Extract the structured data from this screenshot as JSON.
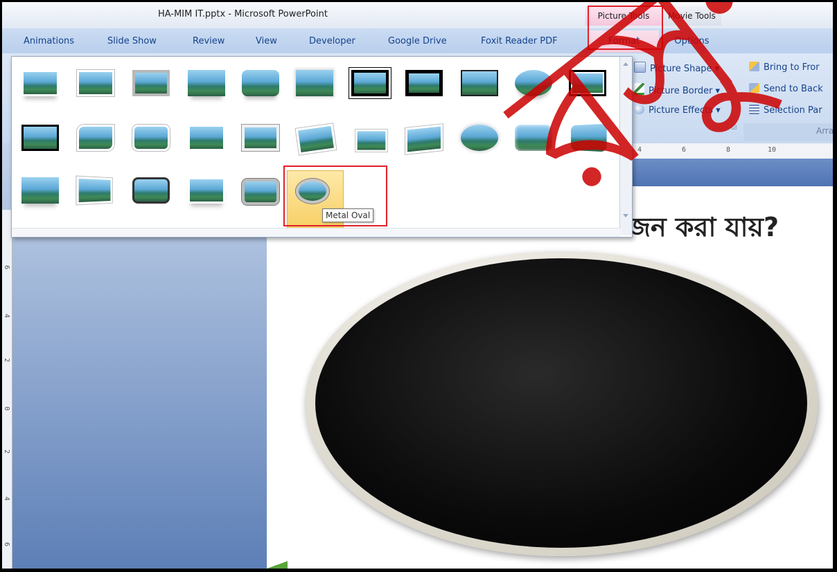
{
  "window": {
    "title": "HA-MIM IT.pptx - Microsoft PowerPoint"
  },
  "context_tabs": {
    "picture_tools": "Picture Tools",
    "movie_tools": "Movie Tools"
  },
  "tabs": [
    "Animations",
    "Slide Show",
    "Review",
    "View",
    "Developer",
    "Google Drive",
    "Foxit Reader PDF"
  ],
  "context_subtabs": {
    "format": "Format",
    "options": "Options"
  },
  "ribbon": {
    "picture_shape": "Picture Shape ▾",
    "picture_border": "Picture Border ▾",
    "picture_effects": "Picture Effects ▾",
    "bring_to_front": "Bring to Fror",
    "send_to_back": "Send to Back",
    "selection_pane": "Selection Par",
    "arrange_label": "Arra"
  },
  "gallery": {
    "tooltip": "Metal Oval",
    "rows": [
      [
        "Simple Frame, White",
        "Beveled Matte, White",
        "Metal Frame",
        "Drop Shadow Rectangle",
        "Reflected Rounded Rectangle",
        "Soft Edge Rectangle",
        "Double Frame, Black",
        "Thick Matte, Black",
        "Simple Frame, Black",
        "Reflected Bevel, White",
        "Center Shadow Rectangle"
      ],
      [
        "Simple Frame, Black 2",
        "Rounded Diagonal Corner, White",
        "Snip Diagonal Corner, White",
        "Moderate Frame, White",
        "Bevel Rectangle",
        "Rotated, White",
        "Perspective Shadow, White",
        "Relaxed Perspective, White",
        "Soft Edge Oval",
        "Bevel Rectangle 2",
        "Bevel Perspective"
      ],
      [
        "Reflected Perspective Right",
        "Bevel Perspective Left, White",
        "Metal Rounded Rectangle",
        "Reflected Bevel, Black",
        "Compound Frame, Black",
        "Metal Oval"
      ]
    ]
  },
  "slide": {
    "heading_partial": "জন করা যায়?"
  },
  "ruler": {
    "labels": [
      "4",
      "6",
      "8",
      "10"
    ]
  },
  "vruler": {
    "labels": [
      "6",
      "4",
      "2",
      "0",
      "2",
      "4",
      "6"
    ]
  },
  "watermark": {
    "text": "রসুন্দ"
  },
  "colors": {
    "highlight_box": "#e0202a",
    "gallery_selected": "#f7cd5f",
    "slide_oval": "#000000"
  }
}
